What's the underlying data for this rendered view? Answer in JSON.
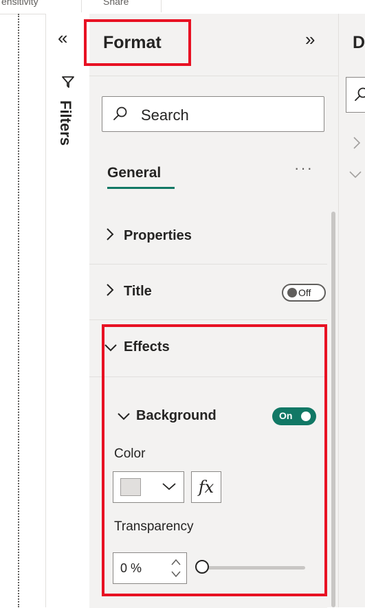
{
  "top_bar": {
    "left_tab": "ensitivity",
    "right_tab": "Share"
  },
  "filters_pane": {
    "collapse_icon": "double-chevron-left-icon",
    "filter_icon": "funnel-icon",
    "label": "Filters"
  },
  "format_pane": {
    "title": "Format",
    "expand_icon": "double-chevron-right-icon",
    "search": {
      "placeholder": "Search",
      "icon": "search-icon"
    },
    "tab": "General",
    "more_options": "···",
    "sections": [
      {
        "label": "Properties",
        "state": "collapsed"
      },
      {
        "label": "Title",
        "state": "collapsed",
        "toggle": "Off"
      },
      {
        "label": "Effects",
        "state": "expanded"
      }
    ],
    "background": {
      "label": "Background",
      "toggle": "On",
      "color_label": "Color",
      "color_value": "#e1dfdd",
      "fx_label": "fx",
      "transparency_label": "Transparency",
      "transparency_value": "0 %",
      "transparency_level": 0
    }
  },
  "data_pane": {
    "title_fragment": "D"
  },
  "colors": {
    "accent": "#117865",
    "highlight": "#e81123",
    "pane_bg": "#f3f2f1"
  }
}
